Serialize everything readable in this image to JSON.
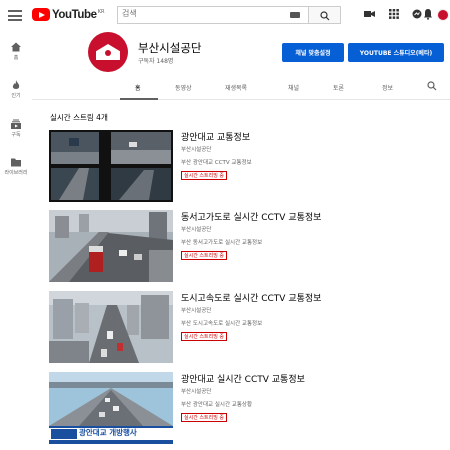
{
  "header": {
    "logo_text": "YouTube",
    "logo_region": "KR",
    "search_placeholder": "검색"
  },
  "sidebar": {
    "items": [
      {
        "label": "홈",
        "icon": "home-icon"
      },
      {
        "label": "인기",
        "icon": "trending-icon"
      },
      {
        "label": "구독",
        "icon": "subscriptions-icon"
      },
      {
        "label": "라이브러리",
        "icon": "library-icon"
      }
    ]
  },
  "channel": {
    "name": "부산시설공단",
    "subscribers": "구독자 148명",
    "custom_button": "채널 맞춤설정",
    "studio_button": "YOUTUBE 스튜디오(베타)"
  },
  "tabs": [
    "홈",
    "동영상",
    "재생목록",
    "채널",
    "토론",
    "정보"
  ],
  "section": {
    "title": "실시간 스트림 4개"
  },
  "videos": [
    {
      "title": "광안대교 교통정보",
      "channel": "부산시설공단",
      "desc": "부산 광안대교 CCTV 교통정보",
      "badge": "실시간 스트리밍 중"
    },
    {
      "title": "동서고가도로 실시간 CCTV 교통정보",
      "channel": "부산시설공단",
      "desc": "부산 동서고가도로 실시간 교통정보",
      "badge": "실시간 스트리밍 중"
    },
    {
      "title": "도시고속도로 실시간 CCTV 교통정보",
      "channel": "부산시설공단",
      "desc": "부산 도시고속도로 실시간 교통정보",
      "badge": "실시간 스트리밍 중"
    },
    {
      "title": "광안대교 실시간 CCTV 교통정보",
      "channel": "부산시설공단",
      "desc": "부산 광안대교 실시간 교통상황",
      "badge": "실시간 스트리밍 중",
      "banner": "광안대교 개방행사"
    }
  ],
  "colors": {
    "brand_red": "#ff0000",
    "button_blue": "#065fd4",
    "live_red": "#cc0000"
  }
}
